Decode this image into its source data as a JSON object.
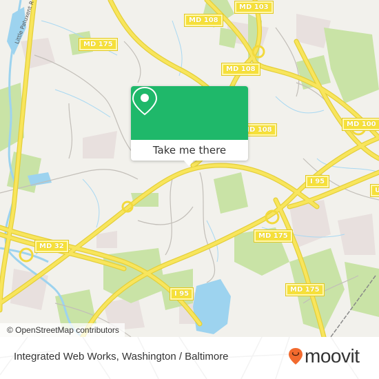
{
  "map": {
    "shields": [
      {
        "id": "md-103",
        "label": "MD 103"
      },
      {
        "id": "md-108-top",
        "label": "MD 108"
      },
      {
        "id": "md-175-nw",
        "label": "MD 175"
      },
      {
        "id": "md-108-mid",
        "label": "MD 108"
      },
      {
        "id": "md-108-right",
        "label": "MD 108"
      },
      {
        "id": "md-100",
        "label": "MD 100"
      },
      {
        "id": "i95-east",
        "label": "I 95"
      },
      {
        "id": "us-edge",
        "label": "U"
      },
      {
        "id": "md-175-center",
        "label": "MD 175"
      },
      {
        "id": "md-32",
        "label": "MD 32"
      },
      {
        "id": "i95-south",
        "label": "I 95"
      },
      {
        "id": "md-175-se",
        "label": "MD 175"
      }
    ],
    "road_labels": {
      "river": "Little Patuxent R"
    },
    "colors": {
      "background": "#f2f1ec",
      "park": "#c9e3a6",
      "water": "#9dd3ef",
      "highway": "#f6e03a",
      "minor_road": "#bdb9b3",
      "urban": "#e8e0de"
    }
  },
  "popup": {
    "icon": "map-pin-icon",
    "button_label": "Take me there",
    "accent_color": "#1fb86a"
  },
  "attribution": {
    "text": "© OpenStreetMap contributors"
  },
  "footer": {
    "title": "Integrated Web Works, Washington / Baltimore",
    "brand": "moovit",
    "brand_color": "#f26a2e"
  }
}
